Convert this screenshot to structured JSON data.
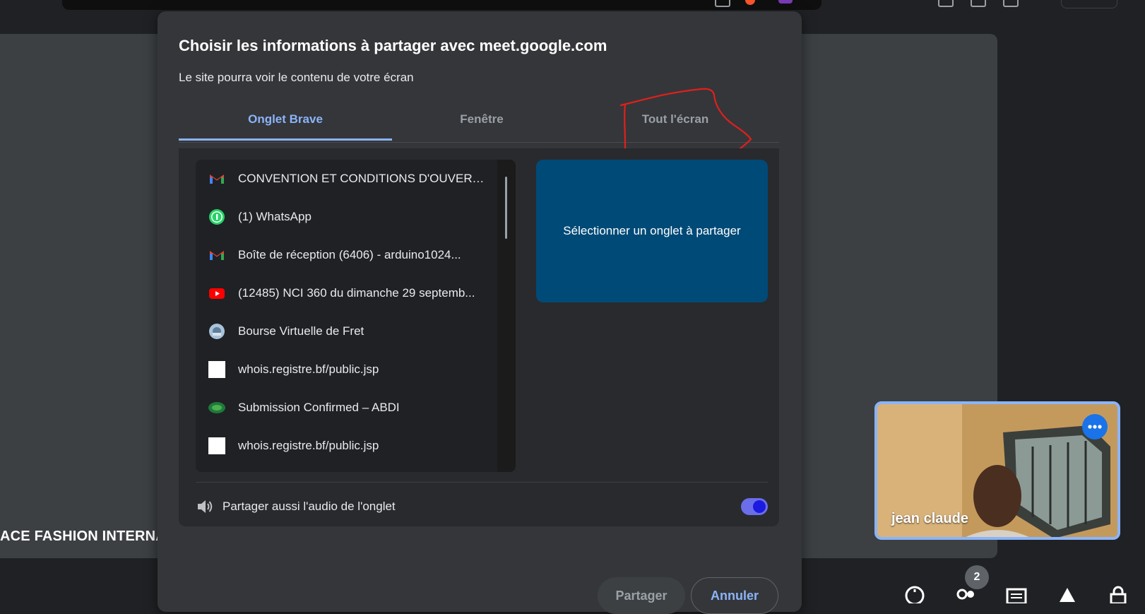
{
  "dialog": {
    "title": "Choisir les informations à partager avec meet.google.com",
    "subtitle": "Le site pourra voir le contenu de votre écran",
    "tabs": [
      {
        "label": "Onglet Brave",
        "active": true
      },
      {
        "label": "Fenêtre",
        "active": false
      },
      {
        "label": "Tout l'écran",
        "active": false
      }
    ],
    "tab_list": [
      {
        "icon": "gmail-icon",
        "label": "CONVENTION ET CONDITIONS D'OUVERT..."
      },
      {
        "icon": "whatsapp-icon",
        "label": "(1) WhatsApp"
      },
      {
        "icon": "gmail-icon",
        "label": "Boîte de réception (6406) - arduino1024..."
      },
      {
        "icon": "youtube-icon",
        "label": "(12485) NCI 360 du dimanche 29 septemb..."
      },
      {
        "icon": "globe-icon",
        "label": "Bourse Virtuelle de Fret"
      },
      {
        "icon": "blank-page-icon",
        "label": "whois.registre.bf/public.jsp"
      },
      {
        "icon": "site-logo-icon",
        "label": "Submission Confirmed – ABDI"
      },
      {
        "icon": "blank-page-icon",
        "label": "whois.registre.bf/public.jsp"
      }
    ],
    "preview_text": "Sélectionner un onglet à partager",
    "audio_label": "Partager aussi l'audio de l'onglet",
    "audio_enabled": true,
    "share_button": "Partager",
    "cancel_button": "Annuler"
  },
  "annotation_color": "#e0201b",
  "stage": {
    "presenter_name": "ACE FASHION INTERNA"
  },
  "self_view": {
    "name": "jean claude"
  },
  "participants_count": "2",
  "colors": {
    "accent": "#8ab4f8",
    "preview_bg": "#004a77",
    "toggle": "#6b6eea"
  }
}
